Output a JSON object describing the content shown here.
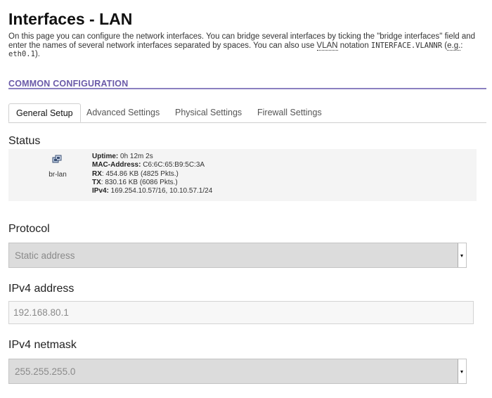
{
  "page": {
    "title": "Interfaces - LAN",
    "description_1": "On this page you can configure the network interfaces. You can bridge several interfaces by ticking the \"bridge interfaces\" field and enter the names of several network interfaces separated by spaces. You can also use ",
    "description_vlan": "VLAN",
    "description_2": " notation ",
    "description_code1": "INTERFACE.VLANNR",
    "description_3": " (",
    "description_eg": "e.g.",
    "description_4": ": ",
    "description_code2": "eth0.1",
    "description_5": ")."
  },
  "section": {
    "title": "COMMON CONFIGURATION"
  },
  "tabs": [
    {
      "label": "General Setup"
    },
    {
      "label": "Advanced Settings"
    },
    {
      "label": "Physical Settings"
    },
    {
      "label": "Firewall Settings"
    }
  ],
  "status": {
    "label": "Status",
    "interface_name": "br-lan",
    "icon": "network-bridge-icon",
    "uptime_label": "Uptime:",
    "uptime_value": " 0h 12m 2s",
    "mac_label": "MAC-Address:",
    "mac_value": " C6:6C:65:B9:5C:3A",
    "rx_label": "RX",
    "rx_value": ": 454.86 KB (4825 Pkts.)",
    "tx_label": "TX",
    "tx_value": ": 830.16 KB (6086 Pkts.)",
    "ipv4_label": "IPv4:",
    "ipv4_value": " 169.254.10.57/16, 10.10.57.1/24"
  },
  "protocol": {
    "label": "Protocol",
    "value": "Static address"
  },
  "ipv4_address": {
    "label": "IPv4 address",
    "value": "192.168.80.1"
  },
  "ipv4_netmask": {
    "label": "IPv4 netmask",
    "value": "255.255.255.0"
  },
  "colors": {
    "section_accent": "#6a5aa8",
    "section_line": "#8b80c0",
    "status_bg": "#f4f4f4",
    "select_bg": "#dcdcdc"
  }
}
